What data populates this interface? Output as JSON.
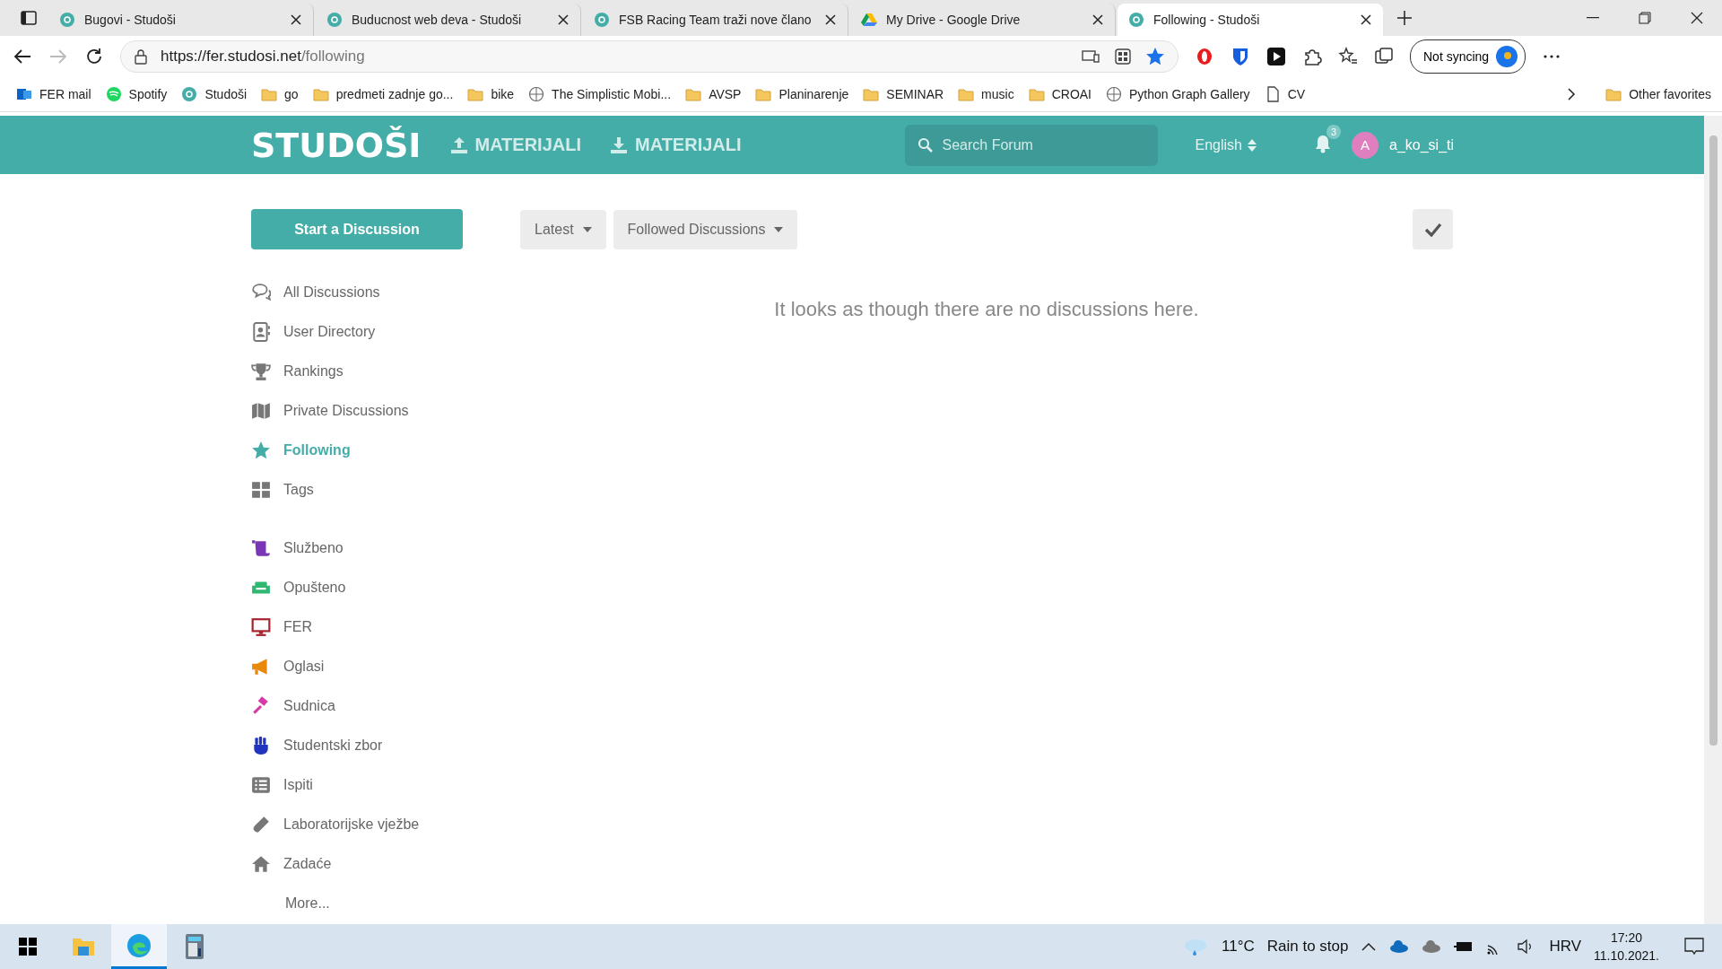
{
  "browser": {
    "tabs": [
      {
        "title": "Bugovi - Studoši",
        "selected": false
      },
      {
        "title": "Buducnost web deva - Studoši",
        "selected": false
      },
      {
        "title": "FSB Racing Team traži nove člano",
        "selected": false
      },
      {
        "title": "My Drive - Google Drive",
        "selected": false
      },
      {
        "title": "Following - Studoši",
        "selected": true
      }
    ],
    "url_host": "https://fer.studosi.net",
    "url_path": "/following",
    "sync_button": "Not syncing",
    "bookmarks": [
      {
        "label": "FER mail",
        "kind": "mail"
      },
      {
        "label": "Spotify",
        "kind": "spotify"
      },
      {
        "label": "Studoši",
        "kind": "site"
      },
      {
        "label": "go",
        "kind": "folder"
      },
      {
        "label": "predmeti zadnje go...",
        "kind": "folder"
      },
      {
        "label": "bike",
        "kind": "folder"
      },
      {
        "label": "The Simplistic Mobi...",
        "kind": "page"
      },
      {
        "label": "AVSP",
        "kind": "folder"
      },
      {
        "label": "Planinarenje",
        "kind": "folder"
      },
      {
        "label": "SEMINAR",
        "kind": "folder"
      },
      {
        "label": "music",
        "kind": "folder"
      },
      {
        "label": "CROAI",
        "kind": "folder"
      },
      {
        "label": "Python Graph Gallery",
        "kind": "page"
      },
      {
        "label": "CV",
        "kind": "doc"
      }
    ],
    "other_favorites": "Other favorites"
  },
  "header": {
    "logo": "STUDOŠI",
    "links": [
      {
        "label": "MATERIJALI",
        "kind": "upload"
      },
      {
        "label": "MATERIJALI",
        "kind": "download"
      }
    ],
    "search": {
      "placeholder": "Search Forum"
    },
    "language": "English",
    "notification_count": "3",
    "avatar_letter": "A",
    "username": "a_ko_si_ti"
  },
  "start_button": "Start a Discussion",
  "nav": [
    {
      "label": "All Discussions",
      "selected": false
    },
    {
      "label": "User Directory",
      "selected": false
    },
    {
      "label": "Rankings",
      "selected": false
    },
    {
      "label": "Private Discussions",
      "selected": false
    },
    {
      "label": "Following",
      "selected": true
    },
    {
      "label": "Tags",
      "selected": false
    }
  ],
  "tags": [
    {
      "label": "Službeno",
      "color": "#7b36b8"
    },
    {
      "label": "Opušteno",
      "color": "#2eb872"
    },
    {
      "label": "FER",
      "color": "#a8242e"
    },
    {
      "label": "Oglasi",
      "color": "#e8890c"
    },
    {
      "label": "Sudnica",
      "color": "#d63aa6"
    },
    {
      "label": "Studentski zbor",
      "color": "#2034c0"
    },
    {
      "label": "Ispiti",
      "color": "#777777"
    },
    {
      "label": "Laboratorijske vježbe",
      "color": "#777777"
    },
    {
      "label": "Zadaće",
      "color": "#777777"
    }
  ],
  "more_link": "More...",
  "toolbar": {
    "sort": "Latest",
    "filter": "Followed Discussions"
  },
  "empty_message": "It looks as though there are no discussions here.",
  "taskbar": {
    "weather": "11°C",
    "forecast": "Rain to stop",
    "language": "HRV",
    "time": "17:20",
    "date": "11.10.2021."
  }
}
